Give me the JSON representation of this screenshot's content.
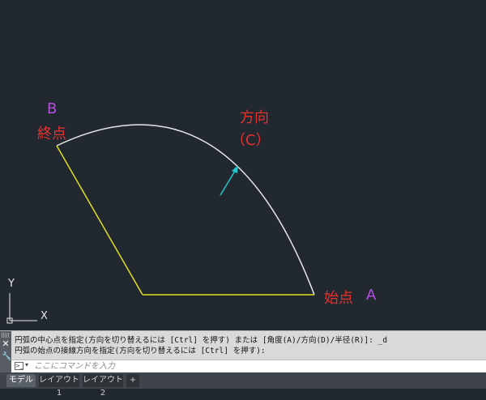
{
  "drawing": {
    "label_b": "B",
    "label_end": "終点",
    "label_dir": "方向",
    "label_c": "（C）",
    "label_start": "始点",
    "label_a": "A",
    "ucs_y": "Y",
    "ucs_x": "X",
    "colors": {
      "background": "#212830",
      "arc": "#e6e6e6",
      "lines": "#e0e020",
      "arrow": "#20c8c8",
      "red_label": "#e8322c",
      "purple_label": "#b44fe0"
    }
  },
  "command": {
    "history": [
      "円弧の中心点を指定(方向を切り替えるには [Ctrl] を押す) または [角度(A)/方向(D)/半径(R)]: _d",
      "円弧の始点の接線方向を指定(方向を切り替えるには [Ctrl] を押す):"
    ],
    "placeholder": "ここにコマンドを入力"
  },
  "tabs": [
    {
      "label": "モデル",
      "active": true
    },
    {
      "label": "レイアウト1",
      "active": false
    },
    {
      "label": "レイアウト2",
      "active": false
    },
    {
      "label": "+",
      "active": false
    }
  ]
}
